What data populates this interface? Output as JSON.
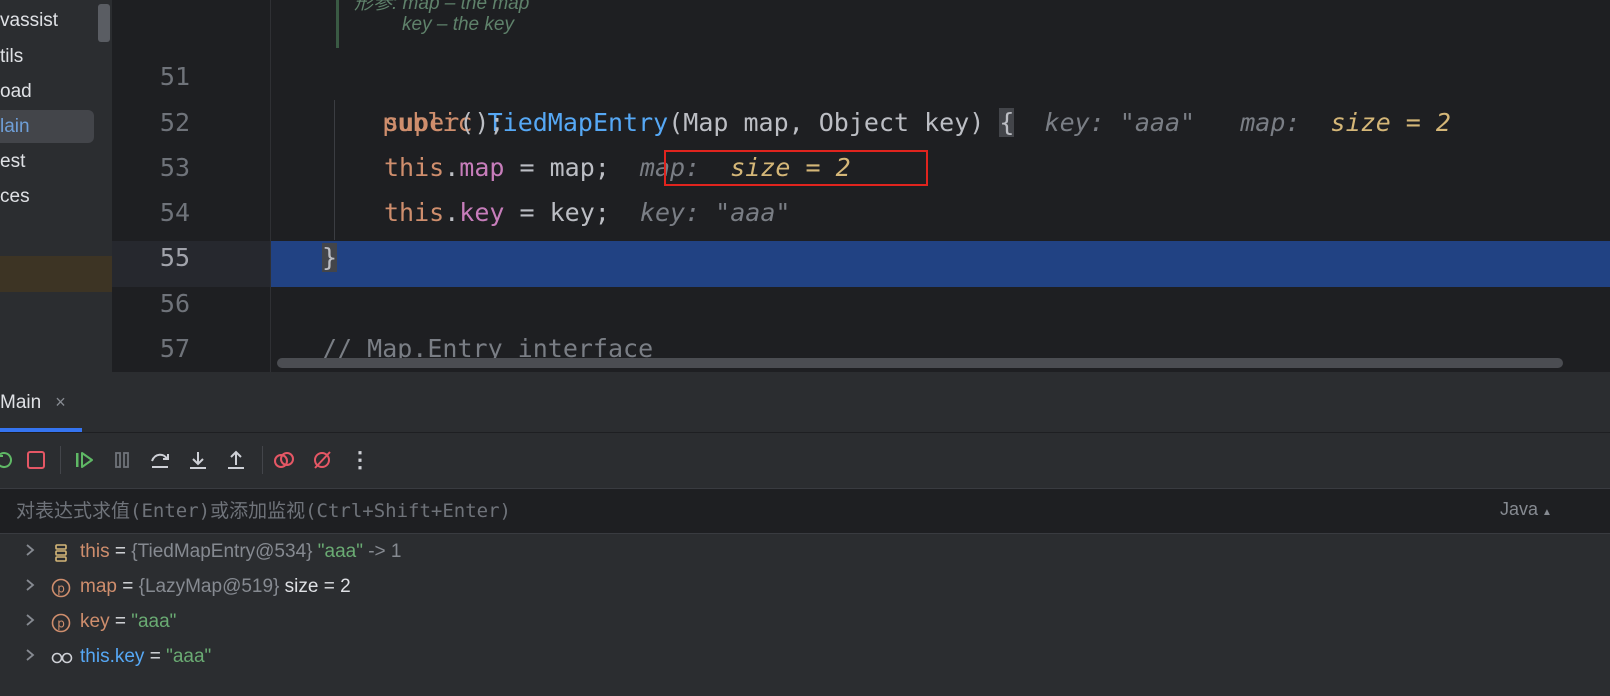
{
  "sidebar": {
    "items": [
      {
        "label": "vassist"
      },
      {
        "label": "tils"
      },
      {
        "label": "oad"
      },
      {
        "label": "lain"
      },
      {
        "label": "est"
      },
      {
        "label": "ces"
      }
    ]
  },
  "editor": {
    "doc_lines": [
      "形参: map – the map",
      "key – the key"
    ],
    "line_numbers": [
      "51",
      "52",
      "53",
      "54",
      "55",
      "56",
      "57"
    ],
    "line51": {
      "kw_public": "public",
      "ctor_name": "TiedMapEntry",
      "params": "(Map map, Object key) ",
      "brace": "{",
      "hint_key_label": "key: ",
      "hint_key_value": "\"aaa\"",
      "hint_map_label": "map: ",
      "hint_map_value": "size = 2"
    },
    "line52": {
      "kw_super": "super",
      "rest": "();"
    },
    "line53": {
      "kw_this": "this",
      "dot": ".",
      "field": "map",
      "rest": " = map;",
      "hint_label": "map: ",
      "hint_value": "size = 2"
    },
    "line54": {
      "kw_this": "this",
      "dot": ".",
      "field": "key",
      "rest": " = key;",
      "hint": "key: \"aaa\""
    },
    "line55": {
      "brace": "}"
    },
    "line57": {
      "comment": "// Map.Entry interface"
    }
  },
  "debug": {
    "tab_label": "Main",
    "tab_close": "×",
    "toolbar": {
      "icons": [
        "rerun-icon",
        "stop-icon",
        "resume-icon",
        "pause-icon",
        "step-over-icon",
        "step-into-icon",
        "step-out-icon",
        "view-breakpoints-icon",
        "mute-breakpoints-icon",
        "more-icon"
      ],
      "more_glyph": "⋮"
    },
    "eval": {
      "placeholder": "对表达式求值(Enter)或添加监视(Ctrl+Shift+Enter)",
      "language": "Java"
    },
    "variables": [
      {
        "name": "this",
        "eq": " = ",
        "type": "{TiedMapEntry@534}",
        "value": " \"aaa\"",
        "extra": " -> 1",
        "icon": "object-icon"
      },
      {
        "name": "map",
        "eq": " = ",
        "type": "{LazyMap@519}",
        "value": "",
        "extra": "  size = 2",
        "icon": "parameter-icon"
      },
      {
        "name": "key",
        "eq": " = ",
        "type": "",
        "value": "\"aaa\"",
        "extra": "",
        "icon": "parameter-icon"
      },
      {
        "name": "this.key",
        "eq": " = ",
        "type": "",
        "value": "\"aaa\"",
        "extra": "",
        "icon": "watch-icon"
      }
    ],
    "param_badge": "p"
  },
  "colors": {
    "accent_selection": "#214283",
    "keyword": "#cf8e6d",
    "function": "#56a8f5",
    "string": "#6aab73",
    "highlight_box": "#e0241e"
  }
}
